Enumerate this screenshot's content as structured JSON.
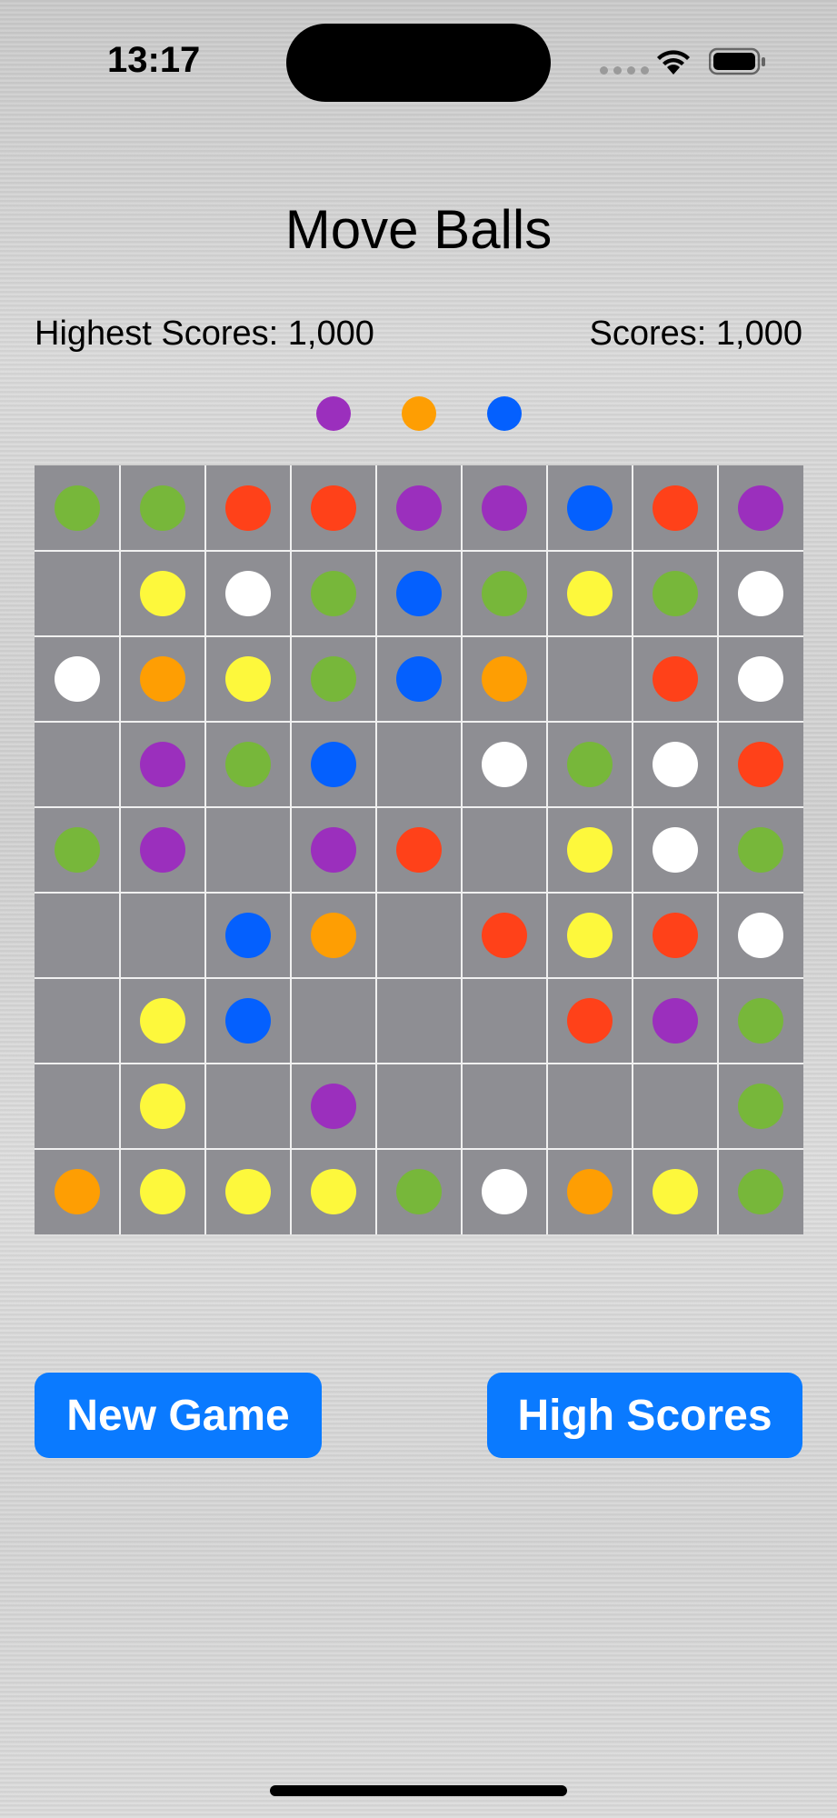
{
  "status": {
    "time": "13:17"
  },
  "title": "Move Balls",
  "scores": {
    "highest": "Highest Scores: 1,000",
    "current": "Scores: 1,000"
  },
  "colors": {
    "green": "#77b73a",
    "red": "#ff4119",
    "purple": "#9b2fbd",
    "blue": "#0460fe",
    "yellow": "#fdf83c",
    "white": "#ffffff",
    "orange": "#fe9e03",
    "board": "#8e8e93",
    "button": "#0a7aff"
  },
  "next_balls": [
    "purple",
    "orange",
    "blue"
  ],
  "board": [
    [
      "green",
      "green",
      "red",
      "red",
      "purple",
      "purple",
      "blue",
      "red",
      "purple"
    ],
    [
      "",
      "yellow",
      "white",
      "green",
      "blue",
      "green",
      "yellow",
      "green",
      "white"
    ],
    [
      "white",
      "orange",
      "yellow",
      "green",
      "blue",
      "orange",
      "",
      "red",
      "white"
    ],
    [
      "",
      "purple",
      "green",
      "blue",
      "",
      "white",
      "green",
      "white",
      "red"
    ],
    [
      "green",
      "purple",
      "",
      "purple",
      "red",
      "",
      "yellow",
      "white",
      "green"
    ],
    [
      "",
      "",
      "blue",
      "orange",
      "",
      "red",
      "yellow",
      "red",
      "white"
    ],
    [
      "",
      "yellow",
      "blue",
      "",
      "",
      "",
      "red",
      "purple",
      "green"
    ],
    [
      "",
      "yellow",
      "",
      "purple",
      "",
      "",
      "",
      "",
      "green"
    ],
    [
      "orange",
      "yellow",
      "yellow",
      "yellow",
      "green",
      "white",
      "orange",
      "yellow",
      "green"
    ]
  ],
  "buttons": {
    "new_game": "New Game",
    "high_scores": "High Scores"
  }
}
